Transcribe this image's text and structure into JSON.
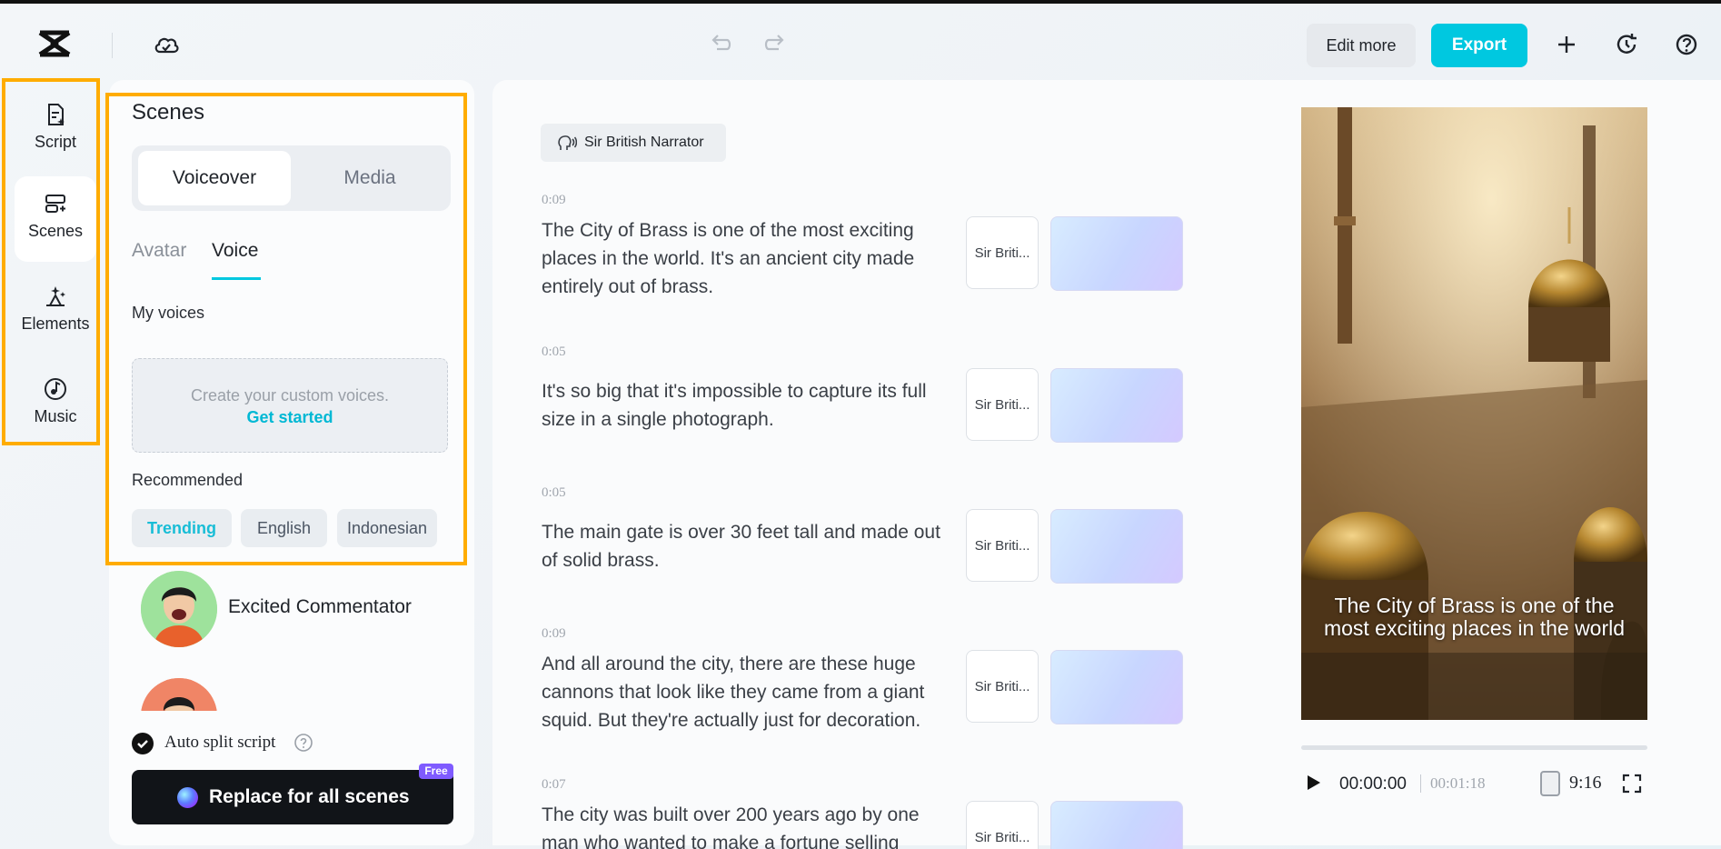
{
  "topbar": {
    "edit_more": "Edit more",
    "export": "Export",
    "icons": [
      "capcut-logo-icon",
      "cloud-icon",
      "undo-icon",
      "redo-icon",
      "plus-icon",
      "history-icon",
      "help-icon"
    ]
  },
  "leftnav": {
    "items": [
      {
        "label": "Script",
        "icon": "script-icon",
        "active": false
      },
      {
        "label": "Scenes",
        "icon": "scenes-icon",
        "active": true
      },
      {
        "label": "Elements",
        "icon": "elements-icon",
        "active": false
      },
      {
        "label": "Music",
        "icon": "music-icon",
        "active": false
      }
    ]
  },
  "panel": {
    "title": "Scenes",
    "segments": [
      "Voiceover",
      "Media"
    ],
    "subtabs": [
      "Avatar",
      "Voice"
    ],
    "my_voices": "My voices",
    "custom_text": "Create your custom voices.",
    "get_started": "Get started",
    "recommended": "Recommended",
    "chips": [
      "Trending",
      "English",
      "Indonesian"
    ],
    "voices": [
      {
        "name": "Excited Commentator"
      }
    ],
    "auto_split": "Auto split script",
    "replace_button": "Replace for all scenes",
    "free_badge": "Free"
  },
  "script": {
    "narrator": "Sir British Narrator",
    "scenes": [
      {
        "time": "0:09",
        "text": "The City of Brass is one of the most exciting places in the world. It's an ancient city made entirely out of brass.",
        "voice": "Sir Briti..."
      },
      {
        "time": "0:05",
        "text": "It's so big that it's impossible to capture its full size in a single photograph.",
        "voice": "Sir Briti..."
      },
      {
        "time": "0:05",
        "text": "The main gate is over 30 feet tall and made out of solid brass.",
        "voice": "Sir Briti..."
      },
      {
        "time": "0:09",
        "text": "And all around the city, there are these huge cannons that look like they came from a giant squid. But they're actually just for decoration.",
        "voice": "Sir Briti..."
      },
      {
        "time": "0:07",
        "text": "The city was built over 200 years ago by one man who wanted to make a fortune selling",
        "voice": "Sir Briti..."
      }
    ]
  },
  "preview": {
    "caption": "The City of Brass is one of the most exciting places in the world",
    "progress": 0,
    "time_current": "00:00:00",
    "time_total": "00:01:18",
    "ratio": "9:16"
  },
  "colors": {
    "accent": "#00c8e0",
    "highlight_border": "#ffac00",
    "free_badge": "#7f5bff"
  }
}
